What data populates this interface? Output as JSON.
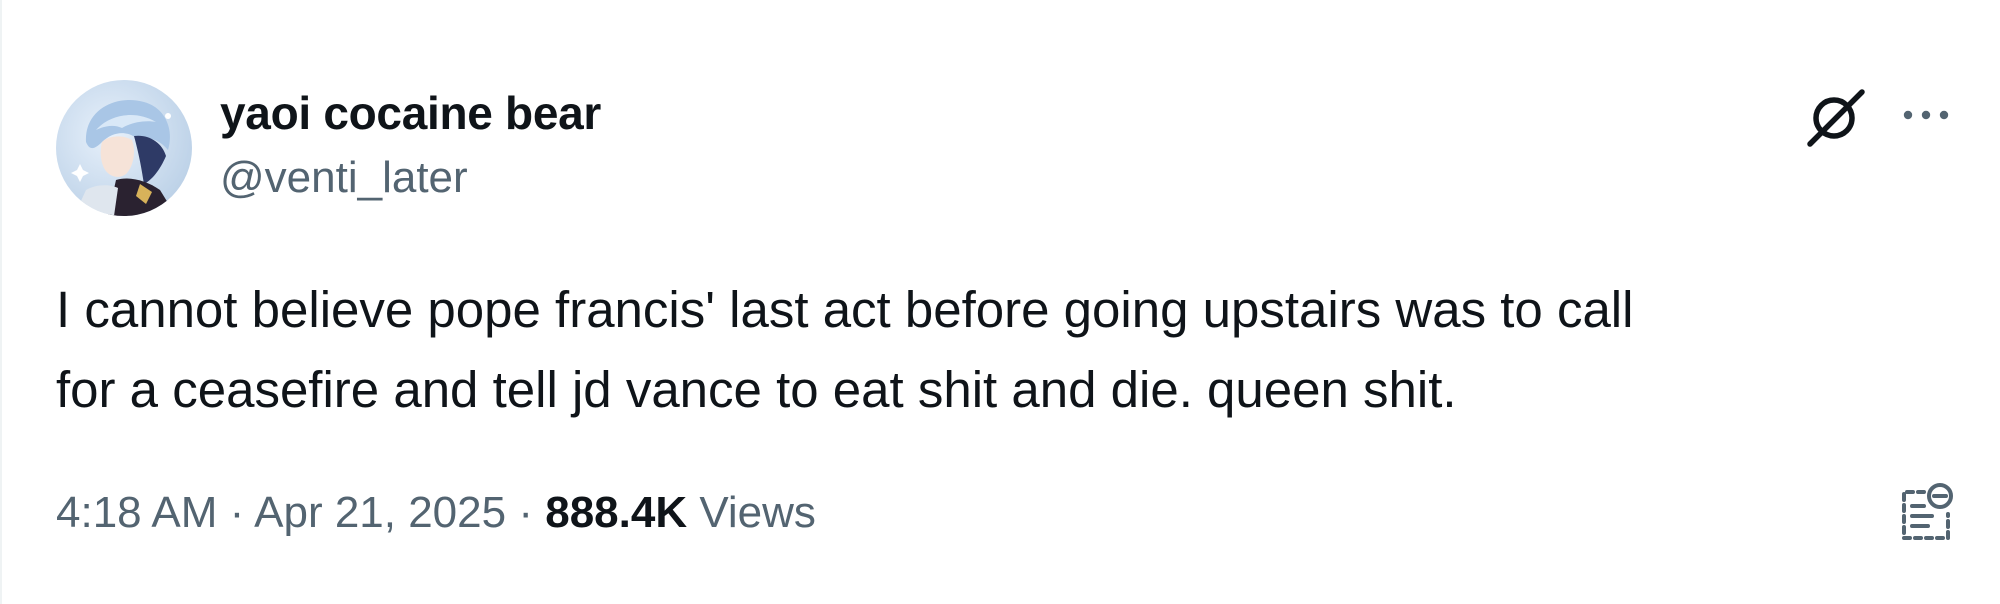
{
  "author": {
    "display_name": "yaoi cocaine bear",
    "handle": "@venti_later"
  },
  "tweet": {
    "text_line_1": "I cannot believe pope francis' last act before going upstairs was to call",
    "text_line_2": "for a ceasefire and tell jd vance to eat shit and die. queen shit."
  },
  "meta": {
    "time": "4:18 AM",
    "separator": "·",
    "date": "Apr 21, 2025",
    "views_count": "888.4K",
    "views_label": "Views"
  },
  "icons": {
    "grok": "grok-icon",
    "more": "more-horizontal-icon",
    "summary": "post-summary-icon"
  },
  "colors": {
    "primary_text": "#0f1419",
    "secondary_text": "#536471",
    "background": "#ffffff"
  }
}
